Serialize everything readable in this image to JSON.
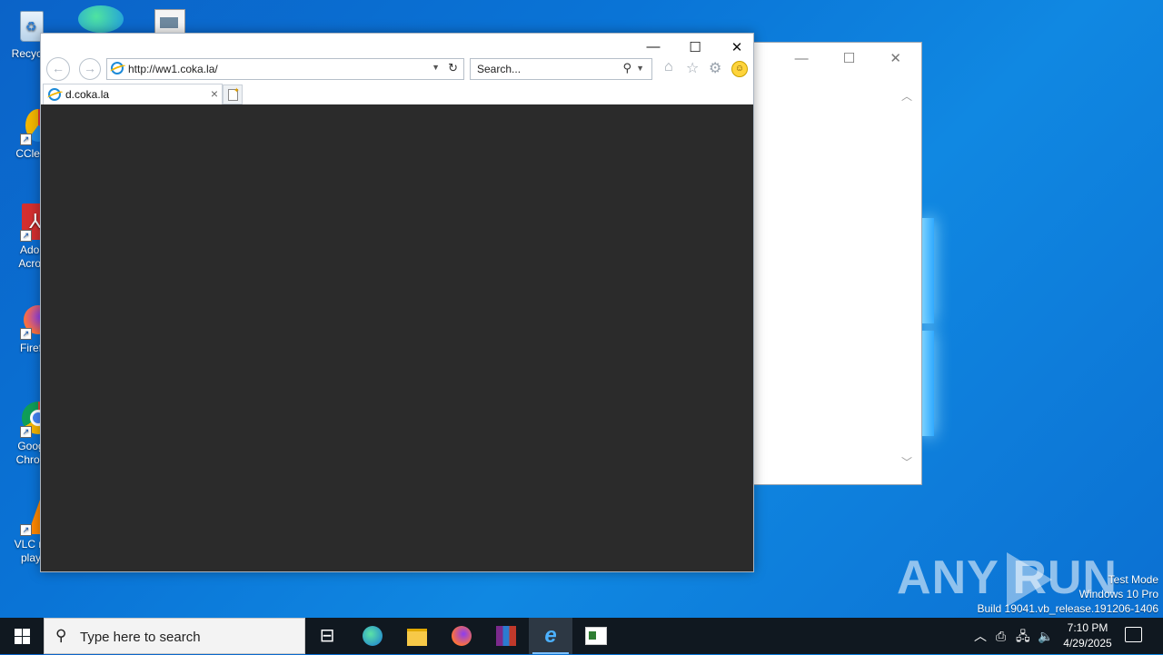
{
  "desktop": {
    "icons": [
      {
        "label": "Recycle",
        "icon": "recycle-bin-icon"
      },
      {
        "label": "CClea",
        "icon": "ccleaner-icon"
      },
      {
        "label": "Adob Acrol",
        "icon": "acrobat-icon"
      },
      {
        "label": "Firef",
        "icon": "firefox-icon"
      },
      {
        "label": "Goog Chron",
        "icon": "chrome-icon"
      },
      {
        "label": "VLC m play",
        "icon": "vlc-icon"
      }
    ]
  },
  "browser": {
    "address_url": "http://ww1.coka.la/",
    "search_placeholder": "Search...",
    "tab_title": "d.coka.la"
  },
  "watermark": {
    "brand": "ANY RUN",
    "line1": "Test Mode",
    "line2": "Windows 10 Pro",
    "line3": "Build 19041.vb_release.191206-1406"
  },
  "taskbar": {
    "search_placeholder": "Type here to search",
    "time": "7:10 PM",
    "date": "4/29/2025"
  }
}
